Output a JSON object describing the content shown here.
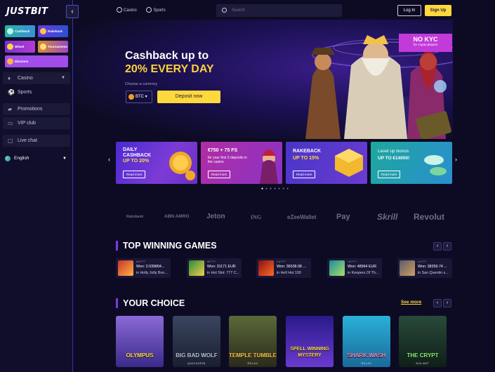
{
  "brand": {
    "logo": "JUSTBIT"
  },
  "sidebar": {
    "tiles": [
      {
        "label": "Cashback"
      },
      {
        "label": "Rakeback"
      },
      {
        "label": "Wheel"
      },
      {
        "label": "Tournaments"
      },
      {
        "label": "Missions"
      }
    ],
    "nav": [
      {
        "label": "Casino",
        "icon": "cards-icon"
      },
      {
        "label": "Sports",
        "icon": "soccer-ball-icon"
      },
      {
        "label": "Promotions",
        "icon": "tag-icon"
      },
      {
        "label": "VIP club",
        "icon": "crown-icon"
      },
      {
        "label": "Live chat",
        "icon": "chat-icon"
      }
    ],
    "language": "English"
  },
  "header": {
    "casino": "Casino",
    "sports": "Sports",
    "search_placeholder": "Search",
    "login": "Log In",
    "signup": "Sign Up"
  },
  "hero": {
    "title_line1": "Cashback up to",
    "title_line2": "20% EVERY DAY",
    "currency_label": "Choose a currency",
    "currency_value": "BTC",
    "deposit": "Deposit now",
    "badge_title": "NO KYC",
    "badge_sub": "for crypto players"
  },
  "promos": [
    {
      "title1": "DAILY",
      "title2": "CASHBACK",
      "title3": "UP TO 20%",
      "sub": "",
      "read_more": "Read more"
    },
    {
      "title1": "€750 + 75 FS",
      "title2": "",
      "title3": "",
      "sub": "for your first 3 deposits in the casino",
      "read_more": "Read more"
    },
    {
      "title1": "RAKEBACK",
      "title2": "UP TO 15%",
      "title3": "",
      "sub": "",
      "read_more": "Read more"
    },
    {
      "title1": "Level up bonus",
      "title2": "UP TO €14000!",
      "title3": "",
      "sub": "",
      "read_more": "Read more"
    }
  ],
  "payments": [
    "Rabobank",
    "ABN AMRO",
    "Jeton",
    "ING",
    "eZeeWallet",
    "Pay",
    "Skrill",
    "Revolut"
  ],
  "top_winning": {
    "title": "TOP WINNING GAMES",
    "items": [
      {
        "user": "Ma*****",
        "win": "Won: 2.039804...",
        "game": "in Holly Jolly Bon..."
      },
      {
        "user": "Mi*****",
        "win": "Won: 31171 EUR",
        "game": "in Hot Slot: 777 C..."
      },
      {
        "user": "Ca*****",
        "win": "Won: 36538.08 ...",
        "game": "in Hell Hot 100"
      },
      {
        "user": "Ch*****",
        "win": "Won: 48964 EUR",
        "game": "in Keepers Of Th..."
      },
      {
        "user": "Lu*****",
        "win": "Won: 38359.74 ...",
        "game": "in San Quentin x..."
      }
    ]
  },
  "your_choice": {
    "title": "YOUR CHOICE",
    "see_more": "See more",
    "games": [
      {
        "name": "OLYMPUS",
        "provider": "",
        "color": "#6a3fb8"
      },
      {
        "name": "BIG BAD WOLF",
        "provider": "QUICKSPIN",
        "color": "#2d3550"
      },
      {
        "name": "TEMPLE TUMBLE",
        "provider": "RELAX",
        "color": "#3d4a2a"
      },
      {
        "name": "SPELL WINNING MYSTERY",
        "provider": "",
        "color": "#3a2a8a"
      },
      {
        "name": "SHARK WASH",
        "provider": "RELAX",
        "color": "#1b8fb0"
      },
      {
        "name": "THE CRYPT",
        "provider": "NOLIMIT",
        "color": "#1f3a2a"
      }
    ]
  }
}
